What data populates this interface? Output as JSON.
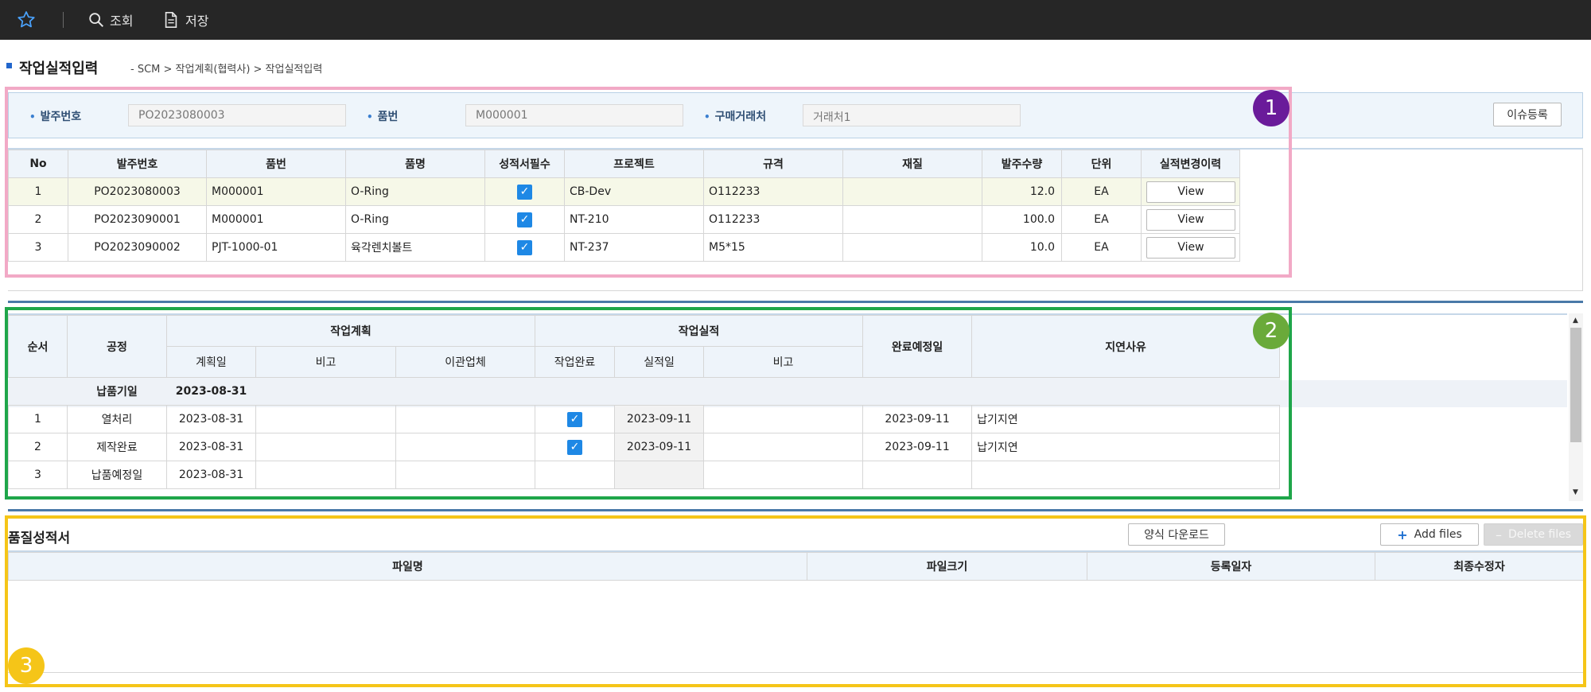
{
  "toolbar": {
    "favorite_icon": "star-icon",
    "search_label": "조회",
    "save_label": "저장"
  },
  "page": {
    "title": "작업실적입력",
    "breadcrumb": "- SCM > 작업계획(협력사) > 작업실적입력"
  },
  "search": {
    "po_label": "발주번호",
    "po_value": "PO2023080003",
    "part_label": "품번",
    "part_value": "M000001",
    "vendor_label": "구매거래처",
    "vendor_value": "거래처1",
    "issue_button": "이슈등록"
  },
  "orders": {
    "headers": [
      "No",
      "발주번호",
      "품번",
      "품명",
      "성적서필수",
      "프로젝트",
      "규격",
      "재질",
      "발주수량",
      "단위",
      "실적변경이력"
    ],
    "view_label": "View",
    "rows": [
      {
        "no": "1",
        "po": "PO2023080003",
        "part": "M000001",
        "name": "O-Ring",
        "cert": true,
        "project": "CB-Dev",
        "spec": "O112233",
        "material": "",
        "qty": "12.0",
        "unit": "EA"
      },
      {
        "no": "2",
        "po": "PO2023090001",
        "part": "M000001",
        "name": "O-Ring",
        "cert": true,
        "project": "NT-210",
        "spec": "O112233",
        "material": "",
        "qty": "100.0",
        "unit": "EA"
      },
      {
        "no": "3",
        "po": "PO2023090002",
        "part": "PJT-1000-01",
        "name": "육각렌치볼트",
        "cert": true,
        "project": "NT-237",
        "spec": "M5*15",
        "material": "",
        "qty": "10.0",
        "unit": "EA"
      }
    ]
  },
  "process": {
    "h_seq": "순서",
    "h_proc": "공정",
    "h_plan": "작업계획",
    "h_plan_date": "계획일",
    "h_plan_note": "비고",
    "h_transfer": "이관업체",
    "h_result": "작업실적",
    "h_done": "작업완료",
    "h_result_date": "실적일",
    "h_result_note": "비고",
    "h_expected": "완료예정일",
    "h_delay": "지연사유",
    "group_label": "납품기일",
    "group_date": "2023-08-31",
    "rows": [
      {
        "seq": "1",
        "proc": "열처리",
        "plan_date": "2023-08-31",
        "done": true,
        "result_date": "2023-09-11",
        "expected": "2023-09-11",
        "delay": "납기지연"
      },
      {
        "seq": "2",
        "proc": "제작완료",
        "plan_date": "2023-08-31",
        "done": true,
        "result_date": "2023-09-11",
        "expected": "2023-09-11",
        "delay": "납기지연"
      },
      {
        "seq": "3",
        "proc": "납품예정일",
        "plan_date": "2023-08-31",
        "done": false,
        "result_date": "",
        "expected": "",
        "delay": ""
      }
    ]
  },
  "quality": {
    "title": "품질성적서",
    "download_button": "양식 다운로드",
    "add_button": "Add files",
    "delete_button": "Delete files",
    "headers": [
      "파일명",
      "파일크기",
      "등록일자",
      "최종수정자"
    ]
  },
  "annotations": {
    "one": "1",
    "two": "2",
    "three": "3",
    "color_one": "#f2a9c6",
    "color_two": "#1fa64a",
    "color_three": "#f5c518"
  }
}
